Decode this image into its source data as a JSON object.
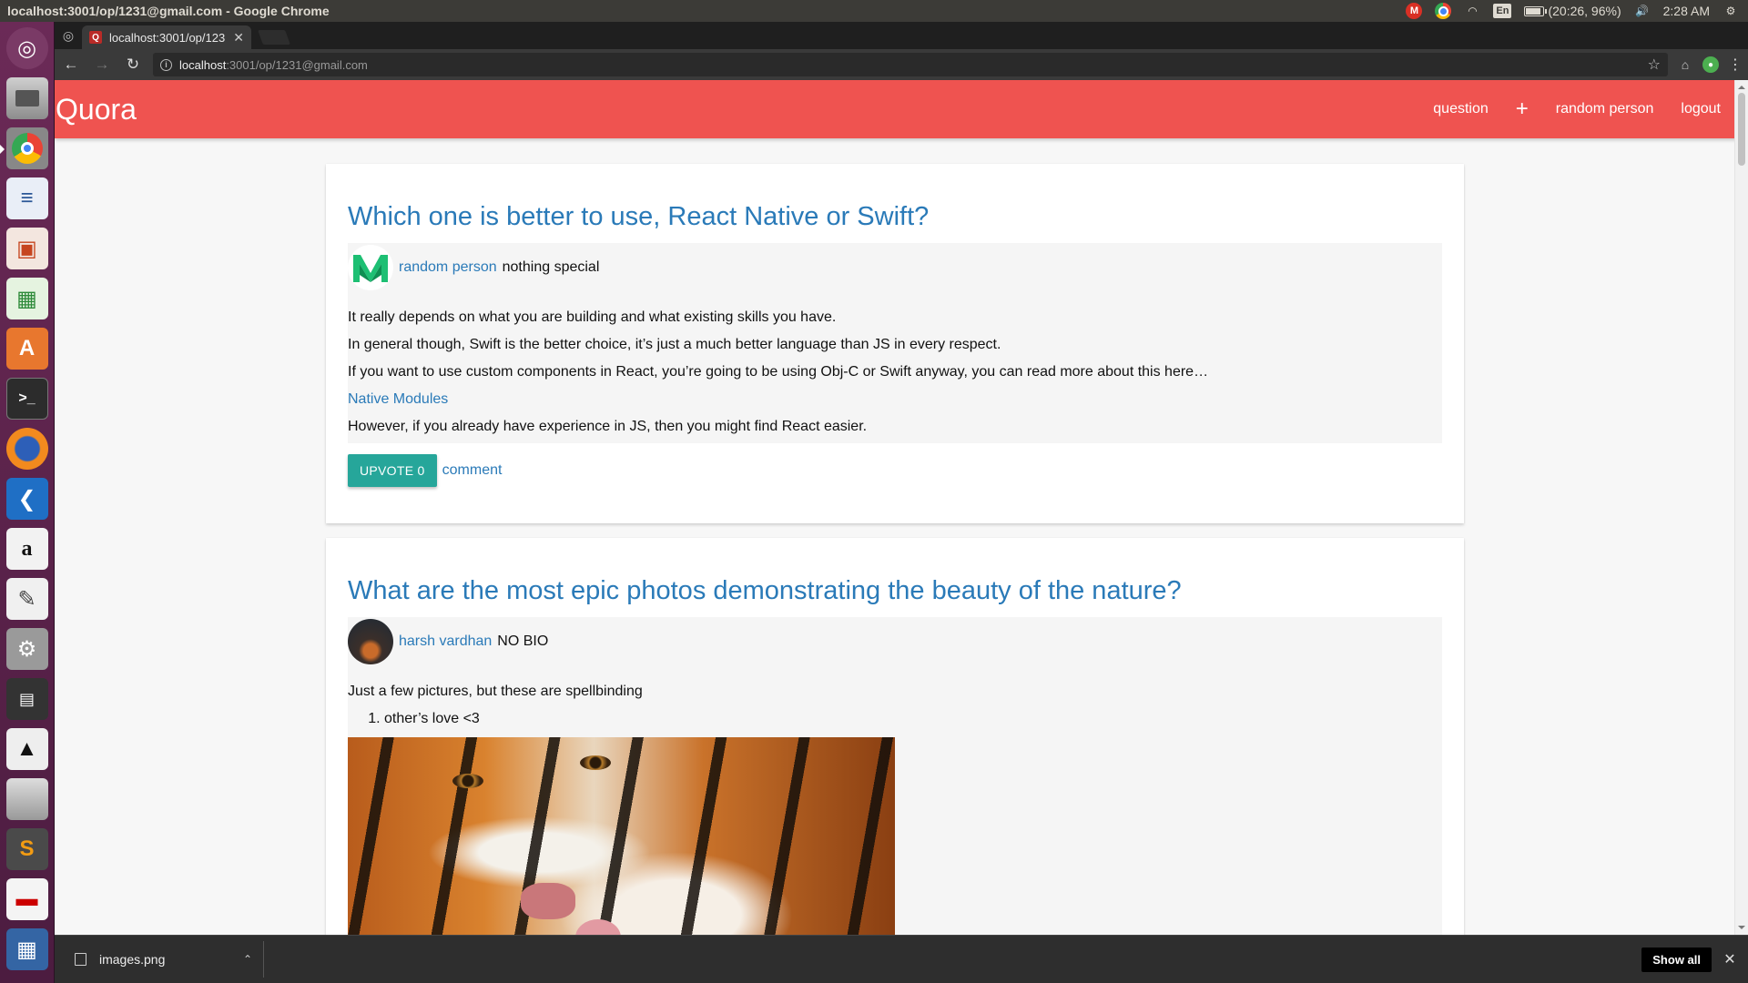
{
  "top_panel": {
    "window_title": "localhost:3001/op/1231@gmail.com - Google Chrome",
    "battery_text": "(20:26, 96%)",
    "clock": "2:28 AM",
    "lang": "En",
    "gmail_letter": "M"
  },
  "launcher": {
    "items": [
      "ubuntu-dash",
      "files",
      "chrome",
      "writer",
      "impress",
      "calc",
      "software-center",
      "terminal",
      "firefox",
      "vscode",
      "amazon",
      "text-editor",
      "system-settings",
      "video-editor",
      "inkscape",
      "disk",
      "sublime-text",
      "drive",
      "workspace"
    ]
  },
  "browser": {
    "tab_title": "localhost:3001/op/1231@gmail.com",
    "favicon_letter": "Q",
    "url_host": "localhost",
    "url_path": ":3001/op/1231@gmail.com"
  },
  "navbar": {
    "brand": "Quora",
    "links": {
      "question": "question",
      "add": "+",
      "profile": "random person",
      "logout": "logout"
    },
    "color": "#ef5350"
  },
  "posts": [
    {
      "title": "Which one is better to use, React Native or Swift?",
      "author": "random person",
      "bio": "nothing special",
      "avatar": "medium-logo",
      "paragraphs": [
        "It really depends on what you are building and what existing skills you have.",
        "In general though, Swift is the better choice, it’s just a much better language than JS in every respect.",
        "If you want to use custom components in React, you’re going to be using Obj-C or Swift anyway, you can read more about this here…"
      ],
      "link_text": "Native Modules",
      "closing": "However, if you already have experience in JS, then you might find React easier.",
      "upvote_label": "UPVOTE 0",
      "comment_label": "comment"
    },
    {
      "title": "What are the most epic photos demonstrating the beauty of the nature?",
      "author": "harsh vardhan",
      "bio": "NO BIO",
      "avatar": "photo",
      "intro": "Just a few pictures, but these are spellbinding",
      "list_item": "other’s love <3",
      "image": "tiger-and-cub-photo"
    }
  ],
  "downloads": {
    "file_name": "images.png",
    "show_all": "Show all"
  },
  "colors": {
    "link": "#2a7ab8",
    "upvote": "#26a69a"
  }
}
